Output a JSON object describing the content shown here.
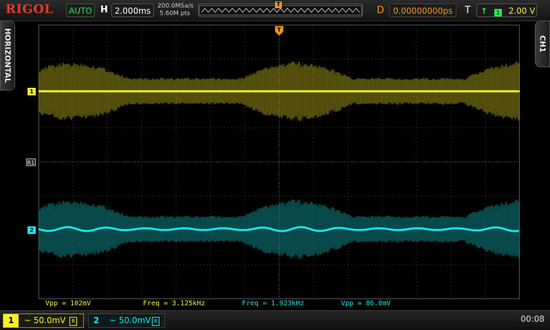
{
  "brand": "RIGOL",
  "header": {
    "run_status": "AUTO",
    "h_label": "H",
    "timebase": "2.000ms",
    "sample_rate": "200.0MSa/s",
    "points": "5.60M pts",
    "trigger_position_marker": "T",
    "delay_label": "D",
    "delay": "0.00000000ps",
    "trigger_label": "T",
    "trigger_source_icon": "1",
    "trigger_level": "2.00 V"
  },
  "side_tabs": {
    "left": "HORIZONTAL",
    "right": "CH1"
  },
  "markers": {
    "ch1": "1",
    "ch2": "2",
    "ref": "R1",
    "trigger_top": "T"
  },
  "measurements": [
    {
      "label": "Vpp = 102mV",
      "color": "#f6f12c"
    },
    {
      "label": "Freq = 3.125kHz",
      "color": "#f6f12c"
    },
    {
      "label": "Freq = 1.923kHz",
      "color": "#19e6e9"
    },
    {
      "label": "Vpp = 86.0mV",
      "color": "#19e6e9"
    }
  ],
  "channels": [
    {
      "number": "1",
      "coupling": "~",
      "scale": "50.0mV",
      "color": "#f6f12c",
      "bw_icon": "B"
    },
    {
      "number": "2",
      "coupling": "~",
      "scale": "50.0mV",
      "color": "#19e6e9",
      "bw_icon": "B"
    }
  ],
  "clock": "00:08",
  "colors": {
    "ch1": "#f6f12c",
    "ch2": "#19e6e9",
    "trigger": "#f29418",
    "run": "#2ee64a",
    "brand": "#e23b2a"
  },
  "icons": {
    "trigger_edge": "rising-edge-icon",
    "bandwidth": "bandwidth-limit-icon",
    "coupling": "ac-coupling-icon"
  }
}
